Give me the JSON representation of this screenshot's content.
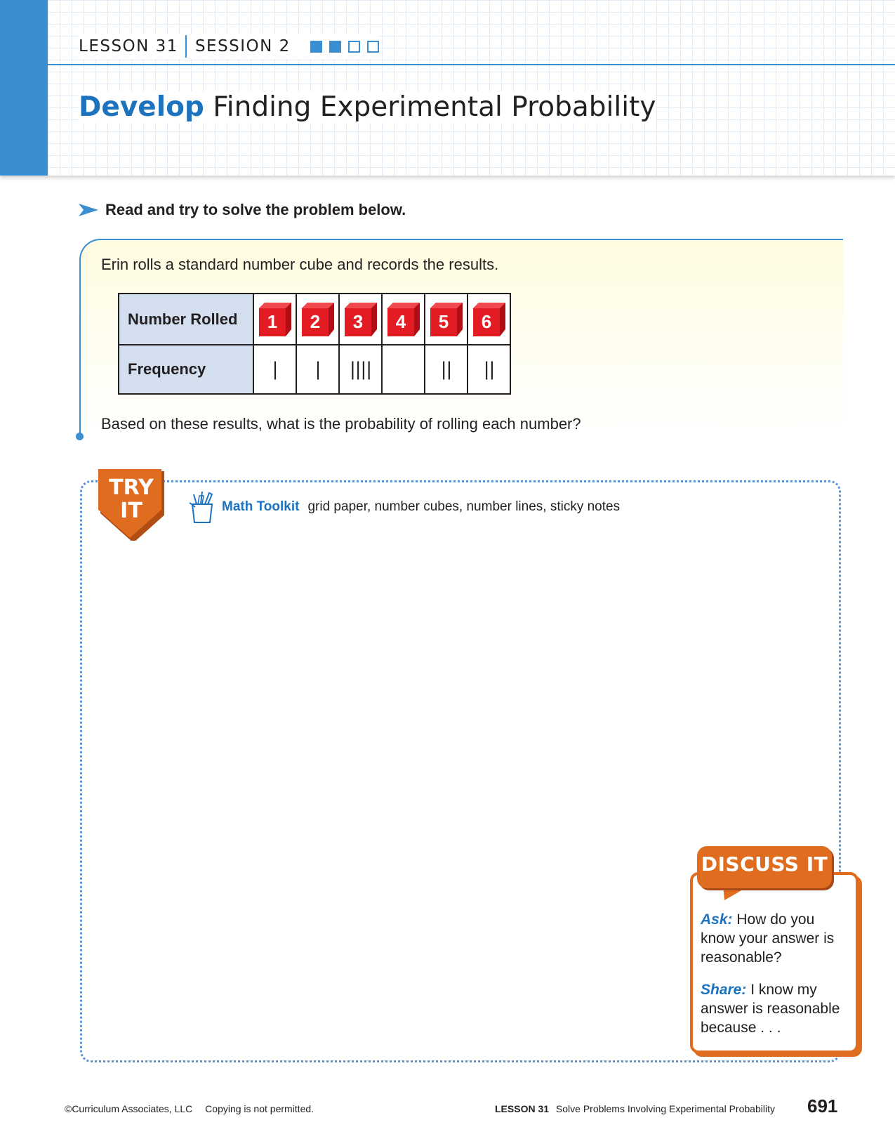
{
  "header": {
    "lesson": "LESSON 31",
    "session": "SESSION 2",
    "progress": [
      true,
      true,
      false,
      false
    ],
    "title_bold": "Develop",
    "title_rest": "Finding Experimental Probability"
  },
  "instruction": "Read and try to solve the problem below.",
  "problem": {
    "intro": "Erin rolls a standard number cube and records the results.",
    "question": "Based on these results, what is the probability of rolling each number?",
    "table": {
      "row1_header": "Number Rolled",
      "row2_header": "Frequency",
      "numbers": [
        "1",
        "2",
        "3",
        "4",
        "5",
        "6"
      ],
      "frequencies": [
        "|",
        "|",
        "||||",
        "",
        "||",
        "||"
      ]
    },
    "die_color": "#d7141a"
  },
  "try_it": {
    "label_line1": "TRY",
    "label_line2": "IT",
    "toolkit_title": "Math Toolkit",
    "toolkit_items": "grid paper, number cubes, number lines, sticky notes"
  },
  "discuss_it": {
    "label": "DISCUSS IT",
    "ask_label": "Ask:",
    "ask_text": "How do you know your answer is reasonable?",
    "share_label": "Share:",
    "share_text": "I know my answer is reasonable because . . ."
  },
  "footer": {
    "copyright": "©Curriculum Associates, LLC",
    "notice": "Copying is not permitted.",
    "lesson": "LESSON 31",
    "lesson_title": "Solve Problems Involving Experimental Probability",
    "page_number": "691"
  },
  "colors": {
    "accent_blue": "#3b8ed0",
    "title_blue": "#1e73be",
    "orange": "#e06c1f"
  }
}
